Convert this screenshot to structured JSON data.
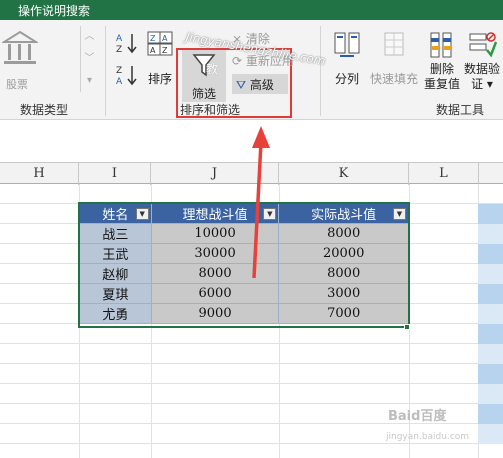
{
  "title_bar": {
    "search_label": "操作说明搜索"
  },
  "ribbon": {
    "data_types_group": {
      "stocks_label": "股票",
      "group_label": "数据类型"
    },
    "sort_filter_group": {
      "sort_label": "排序",
      "filter_label": "筛选",
      "clear_label": "清除",
      "reapply_label": "重新应用",
      "advanced_label": "高级",
      "group_label": "排序和筛选"
    },
    "data_tools_group": {
      "split_label": "分列",
      "flash_fill_label": "快速填充",
      "remove_dup_line1": "删除",
      "remove_dup_line2": "重复值",
      "validation_line1": "数据验",
      "validation_line2": "证 ▾",
      "group_label": "数据工具"
    },
    "watermark_text": "Jingyanshengzhijie.com",
    "watermark_text2": "教"
  },
  "sheet": {
    "columns": [
      "H",
      "I",
      "J",
      "K",
      "L"
    ],
    "table": {
      "headers": [
        "姓名",
        "理想战斗值",
        "实际战斗值"
      ],
      "rows": [
        [
          "战三",
          "10000",
          "8000"
        ],
        [
          "王武",
          "30000",
          "20000"
        ],
        [
          "赵柳",
          "8000",
          "8000"
        ],
        [
          "夏琪",
          "6000",
          "3000"
        ],
        [
          "尤勇",
          "9000",
          "7000"
        ]
      ]
    }
  },
  "watermarks": {
    "baidu": "Baid百度",
    "baidu_url": "jingyan.baidu.com"
  },
  "colors": {
    "title_green": "#217346",
    "table_header": "#3b63a1",
    "highlight_red": "#e03a3a"
  }
}
